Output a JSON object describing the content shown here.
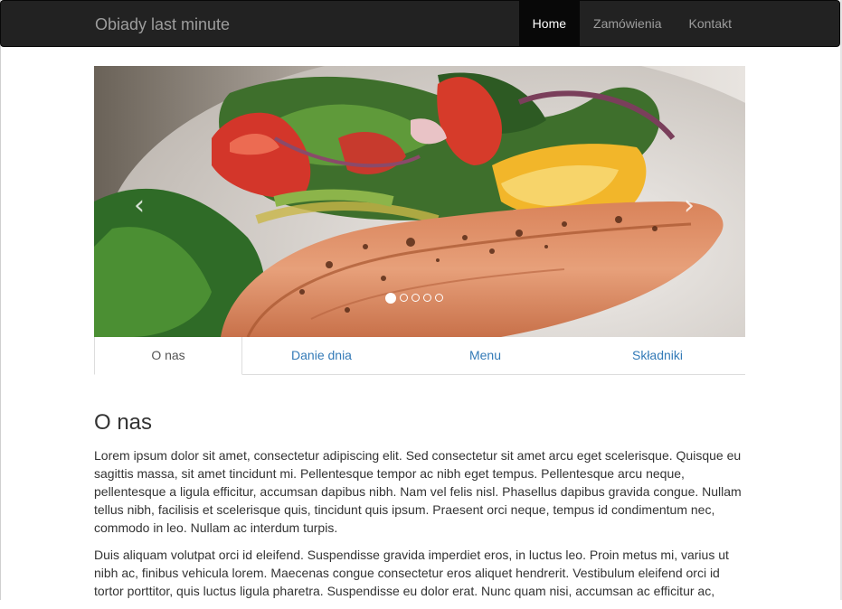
{
  "navbar": {
    "brand": "Obiady last minute",
    "items": [
      {
        "label": "Home",
        "active": true
      },
      {
        "label": "Zamówienia",
        "active": false
      },
      {
        "label": "Kontakt",
        "active": false
      }
    ]
  },
  "carousel": {
    "slide_count": 5,
    "active_index": 0,
    "prev_glyph": "‹",
    "next_glyph": "›"
  },
  "tabs": [
    {
      "label": "O nas",
      "active": true
    },
    {
      "label": "Danie dnia",
      "active": false
    },
    {
      "label": "Menu",
      "active": false
    },
    {
      "label": "Składniki",
      "active": false
    }
  ],
  "content": {
    "heading": "O nas",
    "paragraph1": "Lorem ipsum dolor sit amet, consectetur adipiscing elit. Sed consectetur sit amet arcu eget scelerisque. Quisque eu sagittis massa, sit amet tincidunt mi. Pellentesque tempor ac nibh eget tempus. Pellentesque arcu neque, pellentesque a ligula efficitur, accumsan dapibus nibh. Nam vel felis nisl. Phasellus dapibus gravida congue. Nullam tellus nibh, facilisis et scelerisque quis, tincidunt quis ipsum. Praesent orci neque, tempus id condimentum nec, commodo in leo. Nullam ac interdum turpis.",
    "paragraph2": "Duis aliquam volutpat orci id eleifend. Suspendisse gravida imperdiet eros, in luctus leo. Proin metus mi, varius ut nibh ac, finibus vehicula lorem. Maecenas congue consectetur eros aliquet hendrerit. Vestibulum eleifend orci id tortor porttitor, quis luctus ligula pharetra. Suspendisse eu dolor erat. Nunc quam nisi, accumsan ac efficitur ac,"
  },
  "colors": {
    "navbar_bg": "#222222",
    "link": "#337ab7",
    "text": "#333333"
  }
}
